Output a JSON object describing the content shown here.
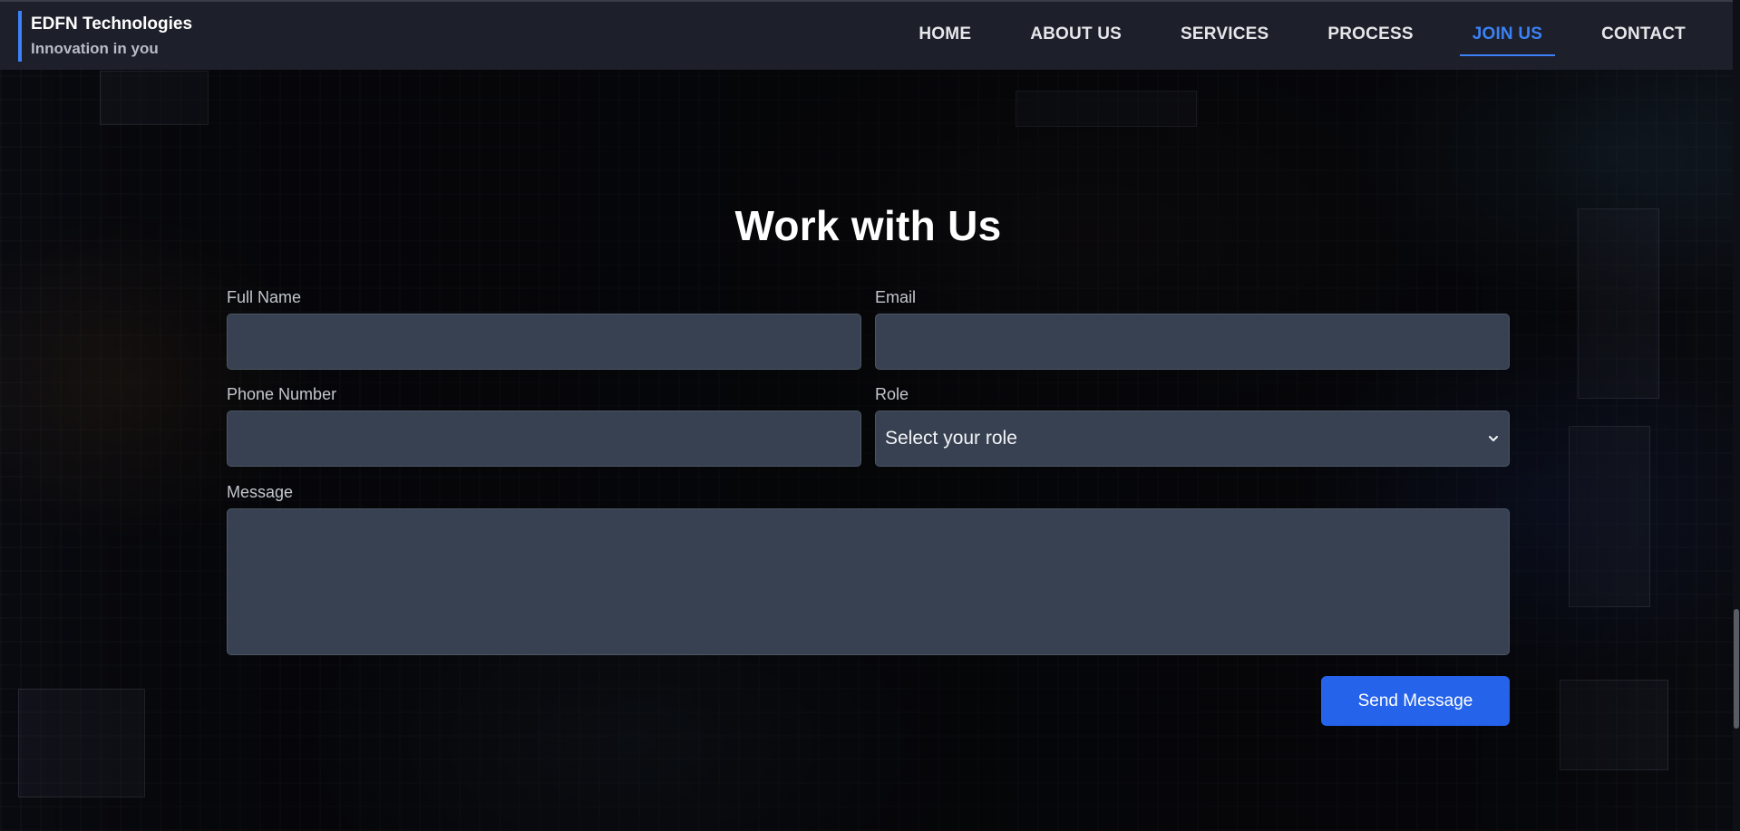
{
  "brand": {
    "name": "EDFN Technologies",
    "tagline": "Innovation in you",
    "accent_color": "#3b82f6"
  },
  "nav": {
    "items": [
      {
        "label": "HOME",
        "active": false
      },
      {
        "label": "ABOUT US",
        "active": false
      },
      {
        "label": "SERVICES",
        "active": false
      },
      {
        "label": "PROCESS",
        "active": false
      },
      {
        "label": "JOIN US",
        "active": true
      },
      {
        "label": "CONTACT",
        "active": false
      }
    ]
  },
  "form": {
    "title": "Work with Us",
    "full_name": {
      "label": "Full Name",
      "value": "",
      "placeholder": ""
    },
    "email": {
      "label": "Email",
      "value": "",
      "placeholder": ""
    },
    "phone": {
      "label": "Phone Number",
      "value": "",
      "placeholder": ""
    },
    "role": {
      "label": "Role",
      "selected": "Select your role"
    },
    "message": {
      "label": "Message",
      "value": ""
    },
    "submit_label": "Send Message",
    "button_color": "#2563eb",
    "field_bg_color": "#374151"
  },
  "icons": {
    "role_dropdown": "chevron-down-icon"
  }
}
